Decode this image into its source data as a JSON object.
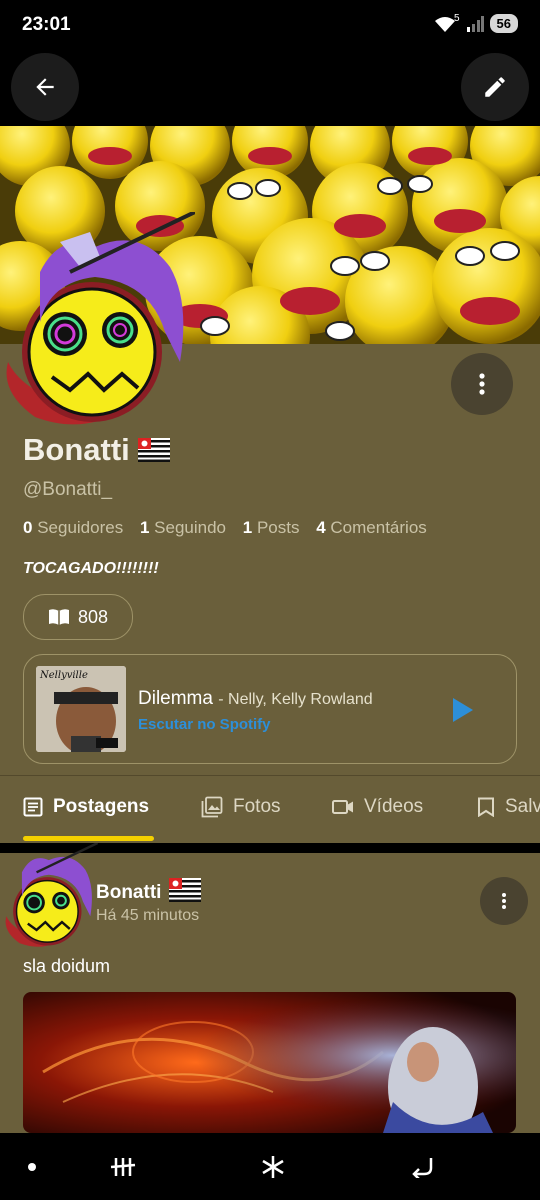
{
  "status_bar": {
    "time": "23:01",
    "network": "5",
    "battery": "56"
  },
  "top_bar": {
    "back_icon": "arrow-left-icon",
    "edit_icon": "pencil-icon"
  },
  "profile": {
    "name": "Bonatti",
    "handle": "@Bonatti_",
    "flag_icon": "sao-paulo-flag-icon",
    "stats": {
      "followers_count": "0",
      "followers_label": "Seguidores",
      "following_count": "1",
      "following_label": "Seguindo",
      "posts_count": "1",
      "posts_label": "Posts",
      "comments_count": "4",
      "comments_label": "Comentários"
    },
    "bio": "TOCAGADO!!!!!!!!",
    "reading_count": "808"
  },
  "spotify": {
    "album_text": "Nellyville",
    "song_title": "Dilemma",
    "song_artist": "- Nelly, Kelly Rowland",
    "listen_label": "Escutar no Spotify"
  },
  "tabs": [
    {
      "label": "Postagens",
      "icon": "article-icon",
      "active": true
    },
    {
      "label": "Fotos",
      "icon": "image-icon",
      "active": false
    },
    {
      "label": "Vídeos",
      "icon": "video-icon",
      "active": false
    },
    {
      "label": "Salvos",
      "icon": "bookmark-icon",
      "active": false
    }
  ],
  "post": {
    "author": "Bonatti",
    "time": "Há 45 minutos",
    "text": "sla doidum"
  },
  "colors": {
    "background": "#6a5f3b",
    "accent_yellow": "#f4d000",
    "spotify_blue": "#2d8fd8",
    "muted_text": "#c9c2a6",
    "border": "#9e9368"
  },
  "nav_bar": {
    "items": [
      "dot-icon",
      "recents-icon",
      "asterisk-icon",
      "back-arrow-icon"
    ]
  }
}
